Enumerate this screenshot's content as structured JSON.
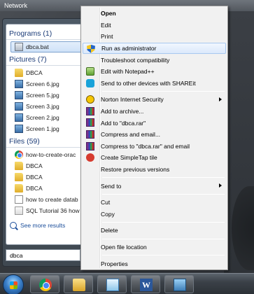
{
  "topbar": {
    "title": "Network"
  },
  "start_menu": {
    "sections": [
      {
        "heading": "Programs (1)",
        "items": [
          {
            "label": "dbca.bat",
            "icon": "batch-file-icon",
            "selected": true
          }
        ]
      },
      {
        "heading": "Pictures (7)",
        "items": [
          {
            "label": "DBCA",
            "icon": "folder-icon"
          },
          {
            "label": "Screen 6.jpg",
            "icon": "image-file-icon"
          },
          {
            "label": "Screen 5.jpg",
            "icon": "image-file-icon"
          },
          {
            "label": "Screen 3.jpg",
            "icon": "image-file-icon"
          },
          {
            "label": "Screen 2.jpg",
            "icon": "image-file-icon"
          },
          {
            "label": "Screen 1.jpg",
            "icon": "image-file-icon"
          }
        ]
      },
      {
        "heading": "Files (59)",
        "items": [
          {
            "label": "how-to-create-orac",
            "icon": "chrome-icon"
          },
          {
            "label": "DBCA",
            "icon": "folder-icon"
          },
          {
            "label": "DBCA",
            "icon": "folder-icon"
          },
          {
            "label": "DBCA",
            "icon": "folder-icon"
          },
          {
            "label": "how to create datab",
            "icon": "document-icon"
          },
          {
            "label": "SQL Tutorial 36 how",
            "icon": "pdf-icon"
          }
        ]
      }
    ],
    "see_more": "See more results",
    "search": {
      "value": "dbca",
      "clear": "×"
    }
  },
  "context_menu": {
    "items": [
      {
        "label": "Open",
        "bold": true
      },
      {
        "label": "Edit"
      },
      {
        "label": "Print"
      },
      {
        "label": "Run as administrator",
        "icon": "shield-icon",
        "hover": true
      },
      {
        "label": "Troubleshoot compatibility"
      },
      {
        "label": "Edit with Notepad++",
        "icon": "notepad-plus-plus-icon"
      },
      {
        "label": "Send to other devices with SHAREit",
        "icon": "shareit-icon"
      },
      {
        "sep": true
      },
      {
        "label": "Norton Internet Security",
        "icon": "norton-icon",
        "submenu": true
      },
      {
        "label": "Add to archive...",
        "icon": "winrar-icon"
      },
      {
        "label": "Add to \"dbca.rar\"",
        "icon": "winrar-icon"
      },
      {
        "label": "Compress and email...",
        "icon": "winrar-icon"
      },
      {
        "label": "Compress to \"dbca.rar\" and email",
        "icon": "winrar-icon"
      },
      {
        "label": "Create SimpleTap tile",
        "icon": "simpletap-icon"
      },
      {
        "label": "Restore previous versions"
      },
      {
        "sep": true
      },
      {
        "label": "Send to",
        "submenu": true
      },
      {
        "sep": true
      },
      {
        "label": "Cut"
      },
      {
        "label": "Copy"
      },
      {
        "sep": true
      },
      {
        "label": "Delete"
      },
      {
        "sep": true
      },
      {
        "label": "Open file location"
      },
      {
        "sep": true
      },
      {
        "label": "Properties"
      }
    ]
  },
  "taskbar": {
    "items": [
      {
        "name": "chrome",
        "icon": "chrome-icon"
      },
      {
        "name": "explorer",
        "icon": "explorer-icon"
      },
      {
        "name": "media-center",
        "icon": "media-icon"
      },
      {
        "name": "word",
        "icon": "word-icon",
        "glyph": "W"
      },
      {
        "name": "photo-viewer",
        "icon": "photo-icon"
      }
    ]
  }
}
